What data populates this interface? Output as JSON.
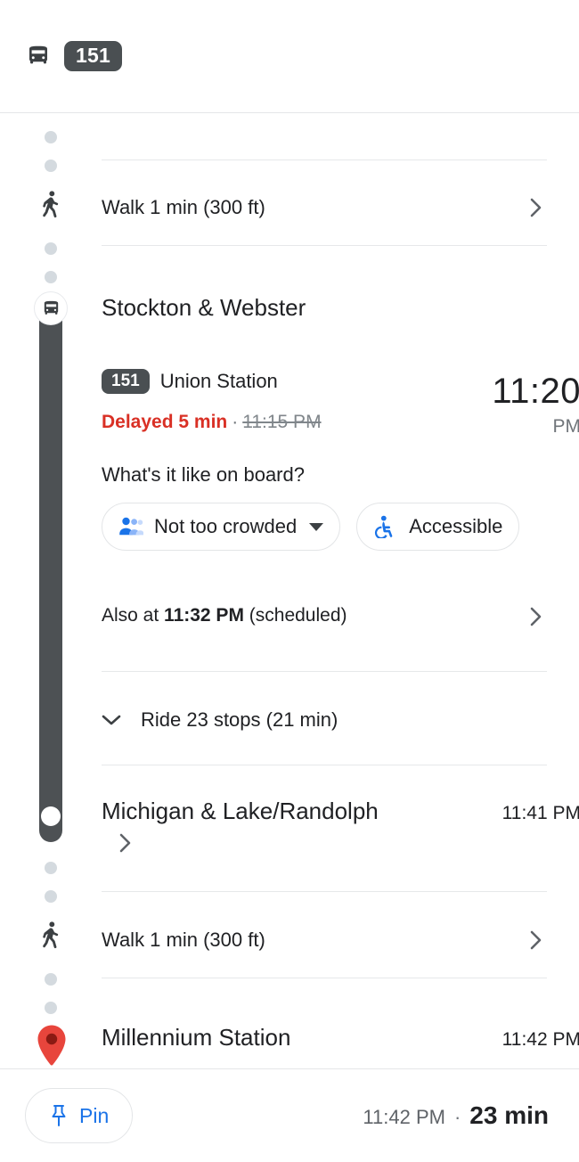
{
  "header": {
    "bus_icon": "bus-icon",
    "route_number": "151"
  },
  "timeline": {
    "walk_top": {
      "icon": "pedestrian-icon",
      "label": "Walk 1 min (300 ft)",
      "chevron": "chevron-right-icon"
    },
    "board_stop": {
      "icon": "bus-icon",
      "name": "Stockton & Webster",
      "route_badge": "151",
      "headsign": "Union Station",
      "delay_text": "Delayed 5 min",
      "delay_separator": "·",
      "scheduled_time": "11:15 PM",
      "departure_time": "11:20",
      "departure_ampm": "PM"
    },
    "onboard": {
      "question": "What's it like on board?",
      "chips": [
        {
          "icon": "people-group-icon",
          "label": "Not too crowded",
          "has_caret": true
        },
        {
          "icon": "wheelchair-icon",
          "label": "Accessible",
          "has_caret": false
        }
      ]
    },
    "also_at": {
      "prefix": "Also at ",
      "time": "11:32 PM",
      "suffix": " (scheduled)",
      "chevron": "chevron-right-icon"
    },
    "ride": {
      "expander": "chevron-down-icon",
      "label": "Ride 23 stops (21 min)"
    },
    "alight_stop": {
      "name": "Michigan & Lake/Randolph",
      "time": "11:41 PM",
      "chevron": "chevron-right-icon"
    },
    "walk_bottom": {
      "icon": "pedestrian-icon",
      "label": "Walk 1 min (300 ft)",
      "chevron": "chevron-right-icon"
    },
    "destination": {
      "icon": "map-pin-icon",
      "name": "Millennium Station",
      "time": "11:42 PM"
    }
  },
  "bottom_bar": {
    "pin_icon": "pin-icon",
    "pin_label": "Pin",
    "arrival_time": "11:42 PM",
    "separator": "·",
    "duration": "23 min"
  },
  "colors": {
    "badge_gray": "#4a4f52",
    "delay_red": "#d93025",
    "accent_blue": "#1a73e8",
    "pin_red": "#e8453c",
    "rail_gray": "#4d5154",
    "dot_gray": "#d4dadf"
  }
}
